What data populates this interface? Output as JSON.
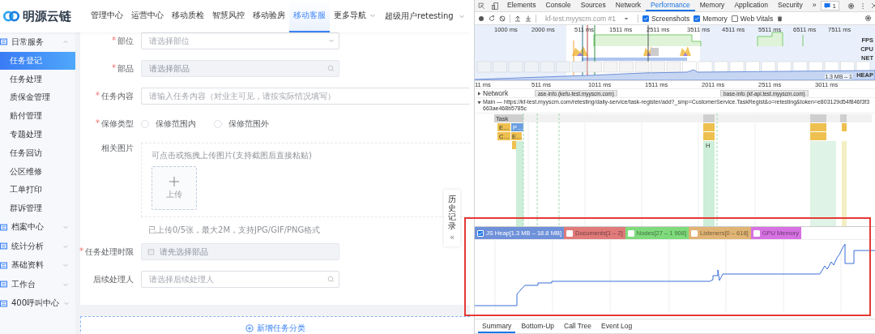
{
  "app": {
    "logo": "明源云链",
    "nav": [
      {
        "label": "管理中心",
        "selected": false,
        "dropdown": false
      },
      {
        "label": "运营中心",
        "selected": false,
        "dropdown": false
      },
      {
        "label": "移动质检",
        "selected": false,
        "dropdown": false
      },
      {
        "label": "智慧风控",
        "selected": false,
        "dropdown": false
      },
      {
        "label": "移动验房",
        "selected": false,
        "dropdown": false
      },
      {
        "label": "移动客服",
        "selected": true,
        "dropdown": false
      },
      {
        "label": "更多导航",
        "selected": false,
        "dropdown": true
      }
    ],
    "user": "超级用户retesting"
  },
  "sidebar": [
    {
      "label": "日常服务",
      "expanded": true,
      "children": [
        {
          "label": "任务登记",
          "selected": true
        },
        {
          "label": "任务处理",
          "selected": false
        },
        {
          "label": "质保金管理",
          "selected": false
        },
        {
          "label": "赔付管理",
          "selected": false
        },
        {
          "label": "专题处理",
          "selected": false
        },
        {
          "label": "任务回访",
          "selected": false
        },
        {
          "label": "公区维修",
          "selected": false
        },
        {
          "label": "工单打印",
          "selected": false
        },
        {
          "label": "群诉管理",
          "selected": false
        }
      ]
    },
    {
      "label": "档案中心",
      "expanded": false
    },
    {
      "label": "统计分析",
      "expanded": false
    },
    {
      "label": "基础资料",
      "expanded": false
    },
    {
      "label": "工作台",
      "expanded": false
    },
    {
      "label": "400呼叫中心",
      "expanded": false
    }
  ],
  "form": {
    "fields": [
      {
        "kind": "select",
        "label": "部位",
        "required_mark": "*",
        "placeholder": "请选择部位",
        "disabled": false
      },
      {
        "kind": "search",
        "label": "部品",
        "required_mark": "*",
        "placeholder": "请选择部品",
        "disabled": true
      },
      {
        "kind": "text",
        "label": "任务内容",
        "required_mark": "*",
        "placeholder": "请输入任务内容（对业主可见，请按实际情况填写）",
        "disabled": false
      },
      {
        "kind": "radio",
        "label": "保修类型",
        "required_mark": "*",
        "options": [
          {
            "label": "保修范围内",
            "selected": false
          },
          {
            "label": "保修范围外",
            "selected": false
          }
        ]
      },
      {
        "kind": "upload",
        "label": "相关图片",
        "hint": "可点击或拖拽上传图片(支持截图后直接粘贴)",
        "button": "上传",
        "note": "已上传0/5张，最大2M，支持JPG/GIF/PNG格式"
      },
      {
        "kind": "date",
        "label": "任务处理时限",
        "required_mark": "*",
        "placeholder": "请先选择部品",
        "disabled": true
      },
      {
        "kind": "search",
        "label": "后续处理人",
        "placeholder": "请选择后续处理人",
        "disabled": false
      }
    ],
    "add_button": "新增任务分类"
  },
  "history_tab": {
    "label": "历史记录",
    "icon": "«"
  },
  "devtools": {
    "tabs": [
      {
        "label": "Elements",
        "selected": false
      },
      {
        "label": "Console",
        "selected": false
      },
      {
        "label": "Sources",
        "selected": false
      },
      {
        "label": "Network",
        "selected": false
      },
      {
        "label": "Performance",
        "selected": true
      },
      {
        "label": "Memory",
        "selected": false
      },
      {
        "label": "Application",
        "selected": false
      },
      {
        "label": "Security",
        "selected": false
      }
    ],
    "more": "»",
    "message_count": "1",
    "toolbar": {
      "target": "kf-test.myyscm.com #1",
      "options": [
        {
          "label": "Screenshots",
          "checked": true
        },
        {
          "label": "Memory",
          "checked": true
        },
        {
          "label": "Web Vitals",
          "checked": false
        }
      ]
    },
    "overview": {
      "ruler": [
        "1000 ms",
        "2000 ms",
        "511 ms",
        "1511 ms",
        "2511 ms",
        "3511 ms",
        "4511 ms",
        "5511 ms",
        "6511 ms",
        "7511 ms"
      ],
      "tracks": [
        "FPS",
        "CPU",
        "NET",
        "HEAP"
      ],
      "heap_range": "1.3 MB – 1"
    },
    "timeline": {
      "ruler": [
        "11 ms",
        "511 ms",
        "1011 ms",
        "1511 ms",
        "2011 ms",
        "2511 ms",
        "3011 ms"
      ],
      "network": {
        "label": "Network",
        "expanded": false,
        "requests": [
          "ase-info (kefu-test.myyscm.com)",
          "base-info (kf-api.test.myyscm.com)"
        ]
      },
      "main": {
        "label": "Main — https://kf-test.myyscm.com/retesting/daily-service/task-register/add?_smp=CustomerService.TaskRegist&o=retesting&token=e803129d54f846f3f3663ae468b5785c",
        "expanded": true
      },
      "blocks": [
        "Task",
        "E…",
        "P…",
        "C…",
        "E…",
        "H"
      ]
    },
    "memory": {
      "counters": [
        {
          "label": "JS Heap[1.3 MB – 18.8 MB]",
          "checked": true,
          "color": "#6f91d9"
        },
        {
          "label": "Documents[1 – 2]",
          "checked": false,
          "color": "#e07b7a"
        },
        {
          "label": "Nodes[27 – 1 908]",
          "checked": false,
          "color": "#7fda7c"
        },
        {
          "label": "Listeners[0 – 618]",
          "checked": false,
          "color": "#e0b474"
        },
        {
          "label": "GPU Memory",
          "checked": false,
          "color": "#d772e2"
        }
      ]
    },
    "bottom_tabs": [
      {
        "label": "Summary",
        "selected": true
      },
      {
        "label": "Bottom-Up",
        "selected": false
      },
      {
        "label": "Call Tree",
        "selected": false
      },
      {
        "label": "Event Log",
        "selected": false
      }
    ]
  }
}
